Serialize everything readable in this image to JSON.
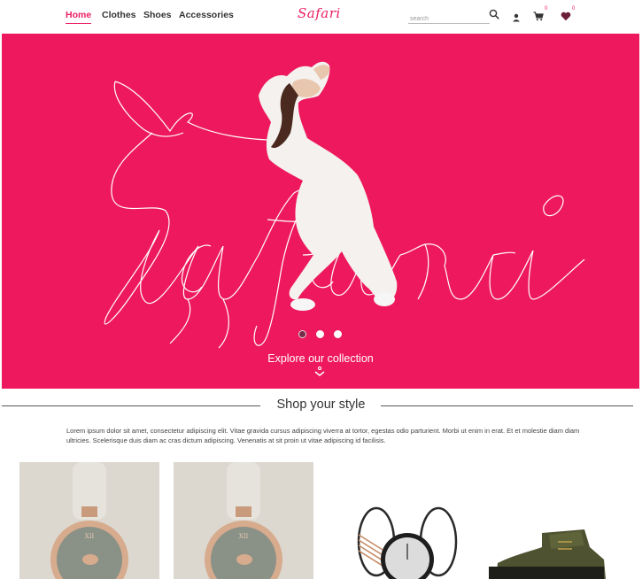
{
  "brand": {
    "logo_text": "Safari",
    "accent": "#e91e63",
    "hero_bg": "#ee185e"
  },
  "nav": {
    "links": [
      {
        "label": "Home",
        "active": true
      },
      {
        "label": "Clothes",
        "active": false
      },
      {
        "label": "Shoes",
        "active": false
      },
      {
        "label": "Accessories",
        "active": false
      }
    ],
    "search_placeholder": "search",
    "icons": [
      "search-icon",
      "user-icon",
      "cart-icon",
      "heart-icon"
    ],
    "cart_count": "0",
    "wishlist_count": "0"
  },
  "hero": {
    "script_text": "Safari",
    "cta": "Explore our collection",
    "slides": 3,
    "active_slide": 1
  },
  "section": {
    "title": "Shop your style",
    "description": "Lorem ipsum dolor sit amet, consectetur adipiscing elit. Vitae gravida cursus adipiscing viverra at tortor, egestas odio parturient. Morbi ut enim in erat. Et et molestie diam diam ultricies. Scelerisque duis diam ac cras dictum adipiscing. Venenatis at sit proin ut vitae adipiscing id facilisis."
  },
  "products": [
    {
      "kind": "watch-rose-gold"
    },
    {
      "kind": "watch-rose-gold"
    },
    {
      "kind": "watch-bangle-black"
    },
    {
      "kind": "boot-olive"
    }
  ]
}
